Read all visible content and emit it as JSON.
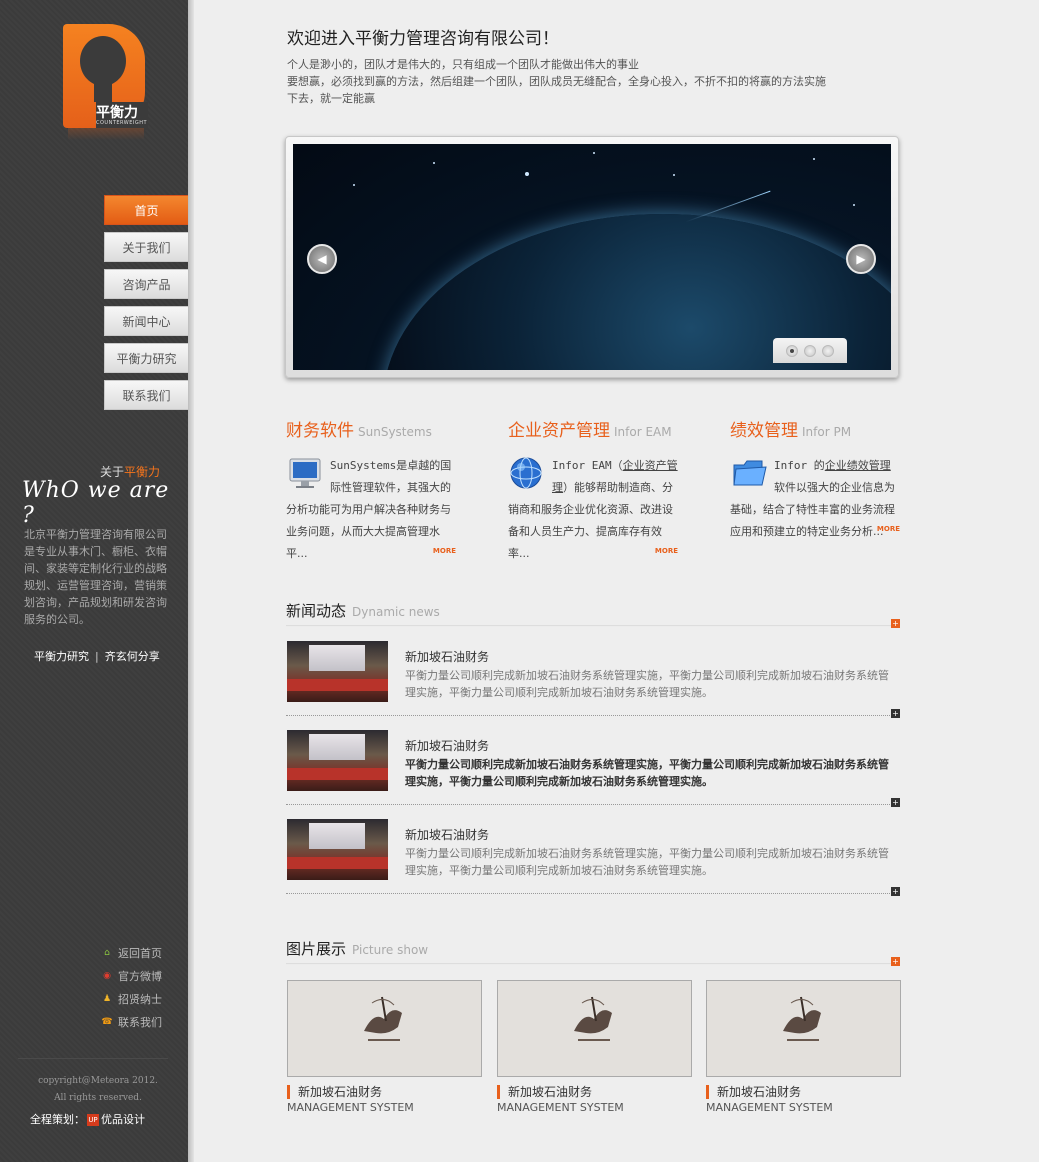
{
  "logo": {
    "cn": "平衡力",
    "en": "COUNTERWEIGHT"
  },
  "nav": [
    "首页",
    "关于我们",
    "咨询产品",
    "新闻中心",
    "平衡力研究",
    "联系我们"
  ],
  "about": {
    "small_prefix": "关于",
    "small_highlight": "平衡力",
    "big": "WhO we are ?",
    "desc": "北京平衡力管理咨询有限公司是专业从事木门、橱柜、衣帽间、家装等定制化行业的战略规划、运营管理咨询，营销策划咨询，产品规划和研发咨询服务的公司。",
    "link1": "平衡力研究",
    "link2": "齐玄何分享"
  },
  "quick_links": [
    {
      "icon": "home-icon",
      "label": "返回首页",
      "color": "#8cc63f"
    },
    {
      "icon": "weibo-icon",
      "label": "官方微博",
      "color": "#e03c2f"
    },
    {
      "icon": "people-icon",
      "label": "招贤纳士",
      "color": "#f0b429"
    },
    {
      "icon": "phone-icon",
      "label": "联系我们",
      "color": "#f39c12"
    }
  ],
  "copyright": [
    "copyright@Meteora 2012.",
    "All rights reserved."
  ],
  "credit": {
    "prefix": "全程策划：",
    "mark": "UP",
    "name": "优品设计"
  },
  "welcome": {
    "title": "欢迎进入平衡力管理咨询有限公司！",
    "lines": [
      "个人是渺小的，团队才是伟大的，只有组成一个团队才能做出伟大的事业",
      "要想赢，必须找到赢的方法，然后组建一个团队，团队成员无缝配合，全身心投入，不折不扣的将赢的方法实施",
      "下去，就一定能赢"
    ]
  },
  "slider": {
    "prev": "◀",
    "next": "▶",
    "dots": 3,
    "active_dot": 0
  },
  "products": [
    {
      "title": "财务软件",
      "en": "SunSystems",
      "icon": "monitor-icon",
      "lead": "SunSystems",
      "text": "是卓越的国际性管理软件，其强大的分析功能可为用户解决各种财务与业务问题，从而大大提高管理水平...",
      "more": "MORE"
    },
    {
      "title": "企业资产管理",
      "en": "Infor EAM",
      "icon": "globe-icon",
      "lead": "Infor EAM（",
      "link": "企业资产管理",
      "text": "）能够帮助制造商、分销商和服务企业优化资源、改进设备和人员生产力、提高库存有效率...",
      "more": "MORE"
    },
    {
      "title": "绩效管理",
      "en": "Infor PM",
      "icon": "folder-icon",
      "lead": "Infor 的",
      "link": "企业绩效管理",
      "text": "软件以强大的企业信息为基础，结合了特性丰富的业务流程应用和预建立的特定业务分析...",
      "more": "MORE"
    }
  ],
  "news_section": {
    "title": "新闻动态",
    "en": "Dynamic news"
  },
  "news": [
    {
      "title": "新加坡石油财务",
      "desc": "平衡力量公司顺利完成新加坡石油财务系统管理实施，平衡力量公司顺利完成新加坡石油财务系统管理实施，平衡力量公司顺利完成新加坡石油财务系统管理实施。"
    },
    {
      "title": "新加坡石油财务",
      "desc": "平衡力量公司顺利完成新加坡石油财务系统管理实施，平衡力量公司顺利完成新加坡石油财务系统管理实施，平衡力量公司顺利完成新加坡石油财务系统管理实施。"
    },
    {
      "title": "新加坡石油财务",
      "desc": "平衡力量公司顺利完成新加坡石油财务系统管理实施，平衡力量公司顺利完成新加坡石油财务系统管理实施，平衡力量公司顺利完成新加坡石油财务系统管理实施。"
    }
  ],
  "pics_section": {
    "title": "图片展示",
    "en": "Picture show"
  },
  "pics": [
    {
      "caption": "新加坡石油财务",
      "sub": "MANAGEMENT SYSTEM"
    },
    {
      "caption": "新加坡石油财务",
      "sub": "MANAGEMENT SYSTEM"
    },
    {
      "caption": "新加坡石油财务",
      "sub": "MANAGEMENT SYSTEM"
    }
  ],
  "colors": {
    "accent": "#e8601c",
    "sidebar": "#3b3b3b",
    "background": "#eeeeee"
  }
}
